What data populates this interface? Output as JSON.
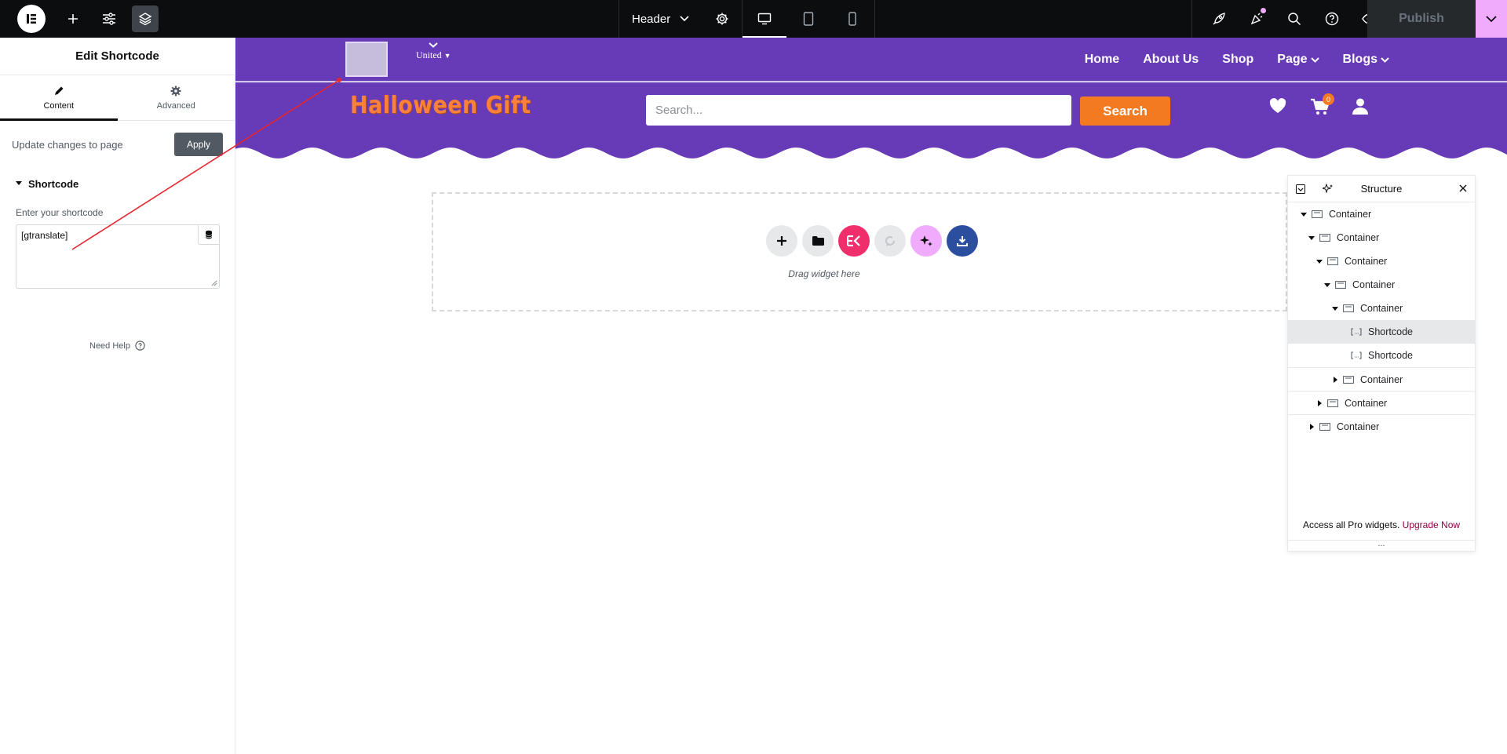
{
  "topbar": {
    "document_name": "Header",
    "publish_label": "Publish"
  },
  "panel": {
    "title": "Edit Shortcode",
    "tabs": [
      {
        "label": "Content",
        "icon": "pencil-icon"
      },
      {
        "label": "Advanced",
        "icon": "gear-icon"
      }
    ],
    "update_text": "Update changes to page",
    "apply_label": "Apply",
    "section_title": "Shortcode",
    "field_label": "Enter your shortcode",
    "shortcode_value": "[gtranslate]",
    "need_help": "Need Help"
  },
  "site": {
    "language": "United",
    "nav": [
      {
        "label": "Home",
        "dropdown": false
      },
      {
        "label": "About Us",
        "dropdown": false
      },
      {
        "label": "Shop",
        "dropdown": false
      },
      {
        "label": "Page",
        "dropdown": true
      },
      {
        "label": "Blogs",
        "dropdown": true
      }
    ],
    "brand": "Halloween Gift",
    "search_placeholder": "Search...",
    "search_button": "Search",
    "cart_count": "0",
    "header_color": "#673ab7",
    "accent_color": "#f47a22"
  },
  "drop_zone": {
    "text": "Drag widget here"
  },
  "structure": {
    "title": "Structure",
    "rows": [
      {
        "label": "Container",
        "depth": 0,
        "expanded": true,
        "type": "container"
      },
      {
        "label": "Container",
        "depth": 1,
        "expanded": true,
        "type": "container"
      },
      {
        "label": "Container",
        "depth": 2,
        "expanded": true,
        "type": "container"
      },
      {
        "label": "Container",
        "depth": 3,
        "expanded": true,
        "type": "container"
      },
      {
        "label": "Container",
        "depth": 4,
        "expanded": true,
        "type": "container"
      },
      {
        "label": "Shortcode",
        "depth": 5,
        "type": "shortcode",
        "selected": true
      },
      {
        "label": "Shortcode",
        "depth": 5,
        "type": "shortcode"
      },
      {
        "label": "Container",
        "depth": 4,
        "expanded": false,
        "type": "container"
      },
      {
        "label": "Container",
        "depth": 2,
        "expanded": false,
        "type": "container"
      },
      {
        "label": "Container",
        "depth": 1,
        "expanded": false,
        "type": "container"
      }
    ],
    "footer_text": "Access all Pro widgets.",
    "footer_link": "Upgrade Now"
  }
}
